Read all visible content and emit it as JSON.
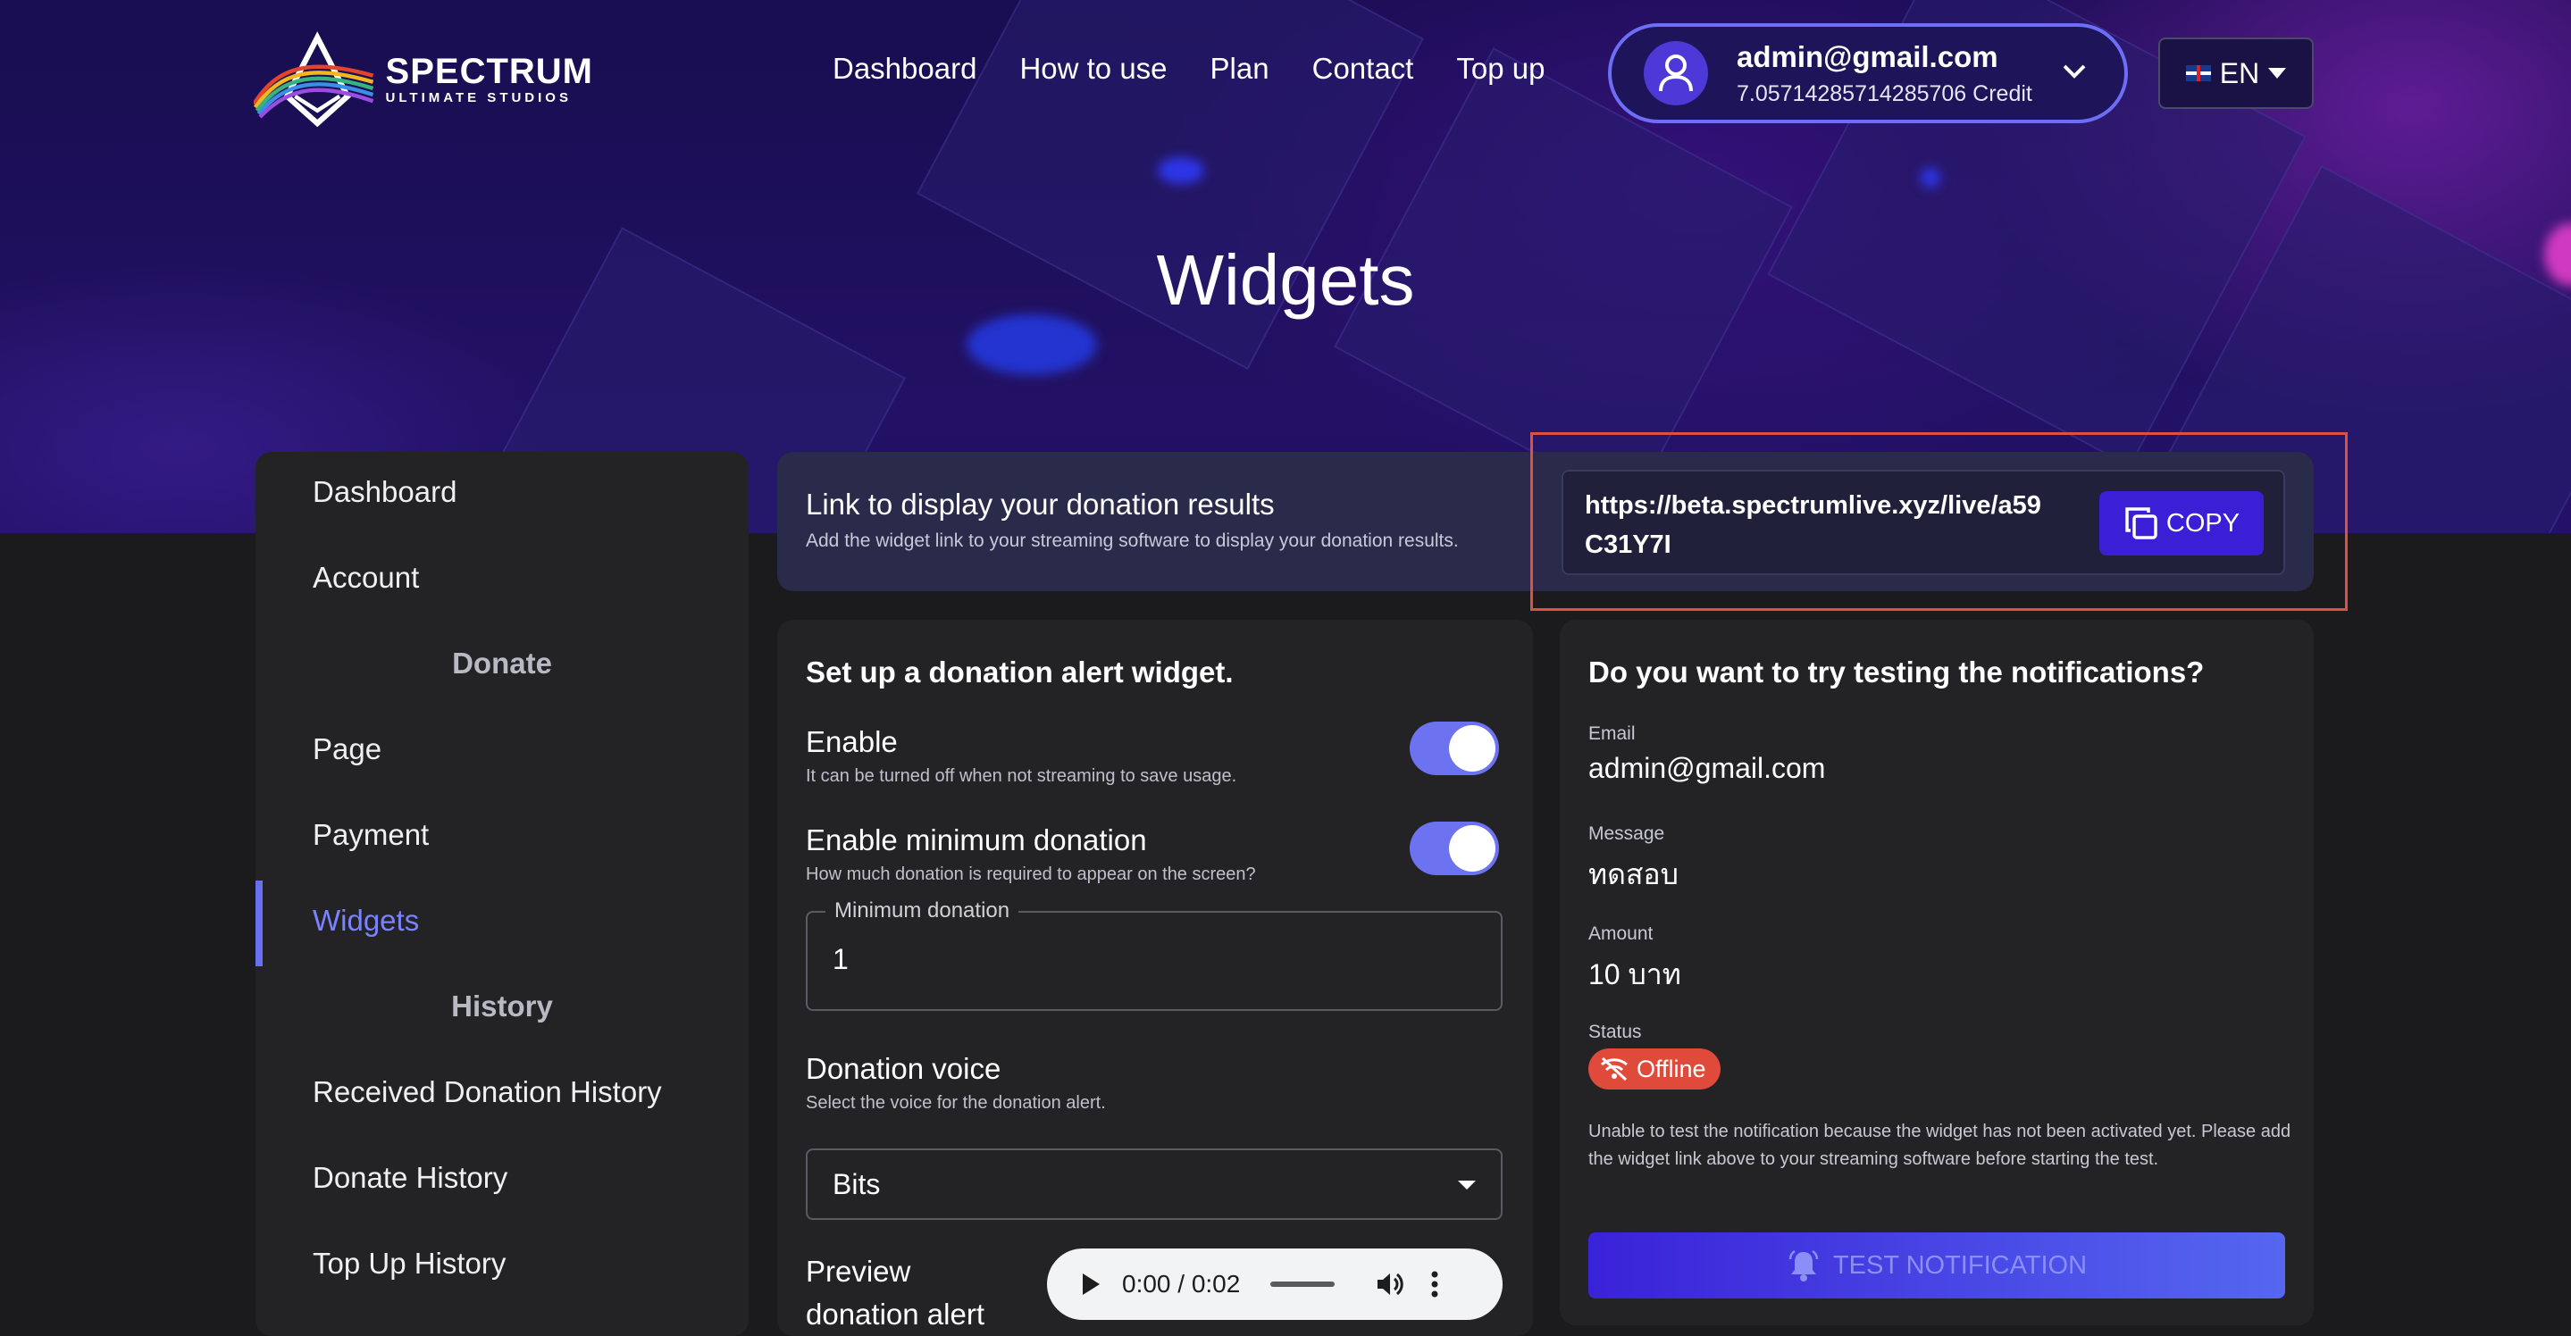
{
  "brand": {
    "name": "SPECTRUM",
    "tagline": "ULTIMATE STUDIOS"
  },
  "nav": [
    "Dashboard",
    "How to use",
    "Plan",
    "Contact",
    "Top up"
  ],
  "account": {
    "email": "admin@gmail.com",
    "credit": "7.05714285714285706 Credit"
  },
  "language": {
    "code": "EN"
  },
  "page_title": "Widgets",
  "sidebar": {
    "items": [
      {
        "label": "Dashboard"
      },
      {
        "label": "Account"
      },
      {
        "label": "Donate"
      },
      {
        "label": "Page"
      },
      {
        "label": "Payment"
      },
      {
        "label": "Widgets",
        "active": true
      },
      {
        "label": "History"
      },
      {
        "label": "Received Donation History"
      },
      {
        "label": "Donate History"
      },
      {
        "label": "Top Up History"
      }
    ]
  },
  "link_card": {
    "title": "Link to display your donation results",
    "subtitle": "Add the widget link to your streaming software to display your donation results.",
    "url": "https://beta.spectrumlive.xyz/live/a59C31Y7I",
    "copy_label": "COPY"
  },
  "alert_widget": {
    "title": "Set up a donation alert widget.",
    "enable": {
      "label": "Enable",
      "description": "It can be turned off when not streaming to save usage.",
      "on": true
    },
    "min_donation": {
      "label": "Enable minimum donation",
      "description": "How much donation is required to appear on the screen?",
      "on": true
    },
    "min_field": {
      "label": "Minimum donation",
      "value": "1"
    },
    "voice": {
      "label": "Donation voice",
      "description": "Select the voice for the donation alert.",
      "selected": "Bits"
    },
    "preview": {
      "label": "Preview donation alert",
      "time": "0:00 / 0:02"
    }
  },
  "test_card": {
    "title": "Do you want to try testing the notifications?",
    "email_label": "Email",
    "email": "admin@gmail.com",
    "message_label": "Message",
    "message": "ทดสอบ",
    "amount_label": "Amount",
    "amount": "10 บาท",
    "status_label": "Status",
    "status": "Offline",
    "note": "Unable to test the notification because the widget has not been activated yet. Please add the widget link above to your streaming software before starting the test.",
    "button": "TEST NOTIFICATION"
  },
  "colors": {
    "accent": "#6c72f0",
    "primary_button": "#3a1fd6",
    "offline": "#e04a3a",
    "highlight": "#e05040"
  }
}
